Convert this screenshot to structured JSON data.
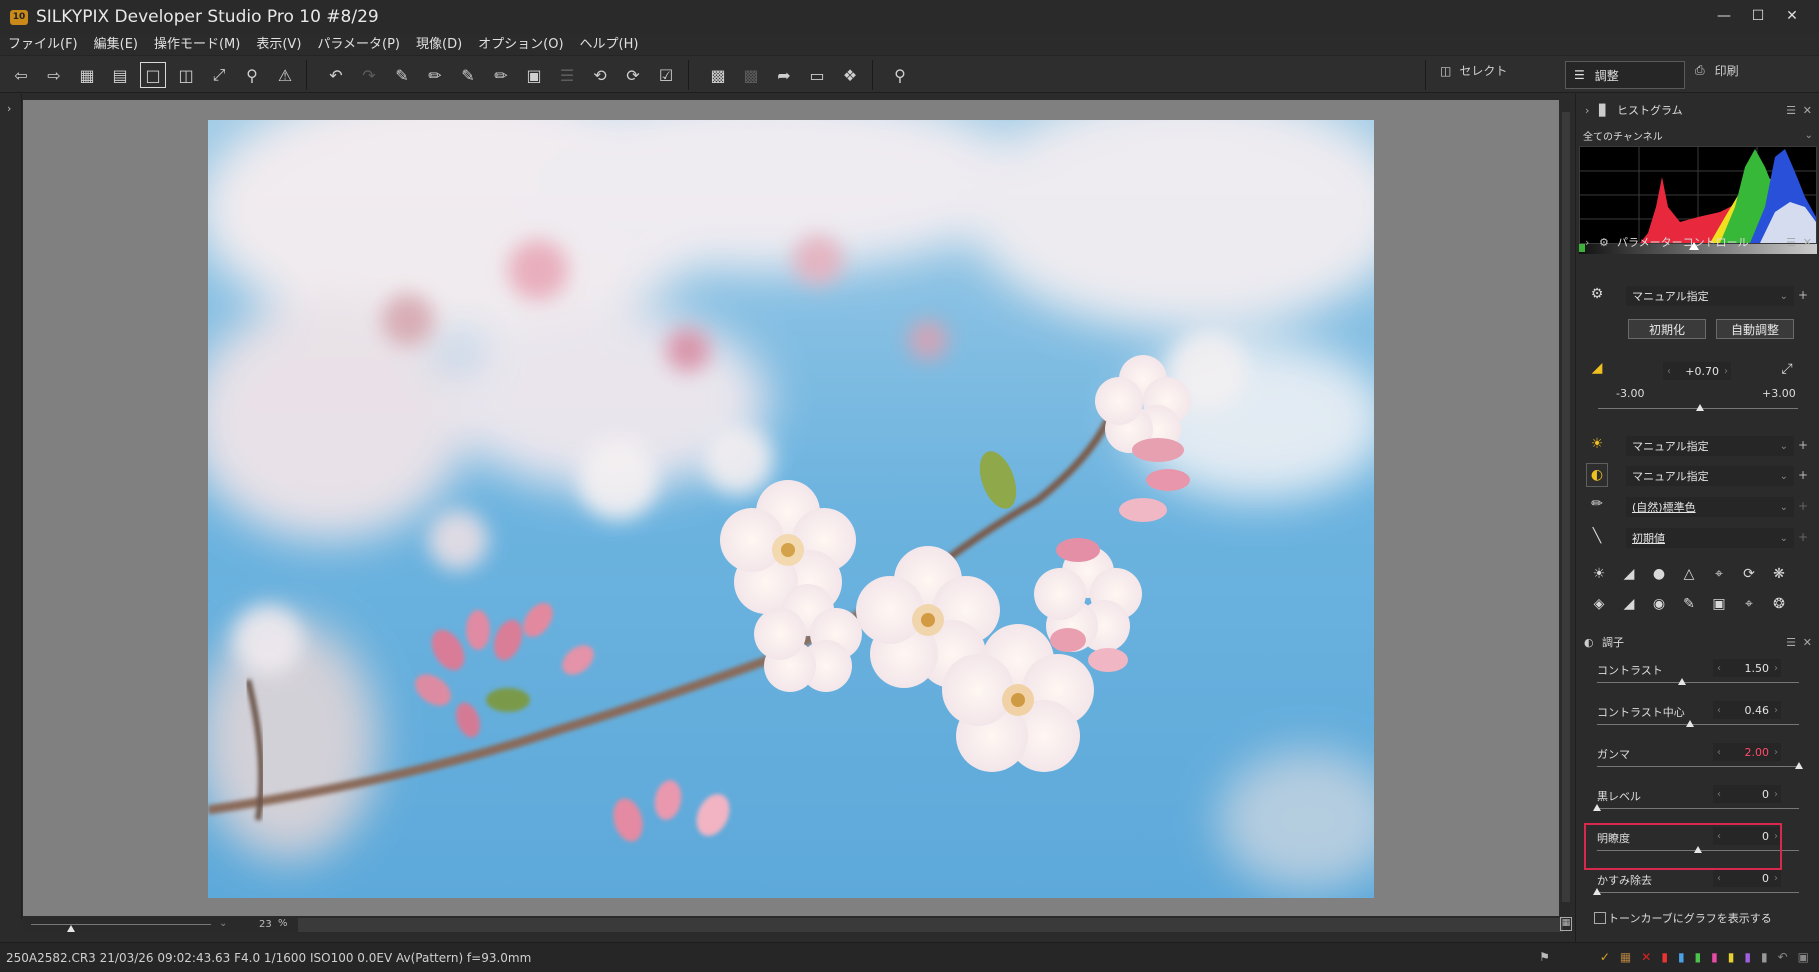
{
  "titlebar": {
    "logo": "10",
    "title": "SILKYPIX Developer Studio Pro 10    #8/29"
  },
  "menu": [
    "ファイル(F)",
    "編集(E)",
    "操作モード(M)",
    "表示(V)",
    "パラメータ(P)",
    "現像(D)",
    "オプション(O)",
    "ヘルプ(H)"
  ],
  "toolbar": {
    "mode_select": "セレクト",
    "mode_adjust": "調整",
    "mode_print": "印刷"
  },
  "viewer": {
    "zoom": "23",
    "zoom_unit": "%"
  },
  "status": {
    "info": "250A2582.CR3 21/03/26 09:02:43.63 F4.0 1/1600 ISO100  0.0EV Av(Pattern) f=93.0mm"
  },
  "histogram_panel": {
    "title": "ヒストグラム",
    "channel": "全てのチャンネル"
  },
  "param_panel": {
    "title": "パラメーターコントロール",
    "preset": "マニュアル指定",
    "init_button": "初期化",
    "auto_button": "自動調整",
    "exposure": {
      "value": "+0.70",
      "min": "-3.00",
      "max": "+3.00"
    },
    "wb": "マニュアル指定",
    "tone": "マニュアル指定",
    "color": "(自然)標準色",
    "sharpness": "初期値"
  },
  "tone_panel": {
    "title": "調子",
    "sliders": [
      {
        "label": "コントラスト",
        "value": "1.50",
        "level": 0.42
      },
      {
        "label": "コントラスト中心",
        "value": "0.46",
        "level": 0.46
      },
      {
        "label": "ガンマ",
        "value": "2.00",
        "level": 1.0
      },
      {
        "label": "黒レベル",
        "value": "0",
        "level": 0.0
      },
      {
        "label": "明瞭度",
        "value": "0",
        "level": 0.5
      },
      {
        "label": "かすみ除去",
        "value": "0",
        "level": 0.0
      }
    ],
    "show_graph": "トーンカーブにグラフを表示する"
  },
  "colors": {
    "accent_highlight": "#d9284d",
    "gamma_value": "#ff4a6a"
  }
}
